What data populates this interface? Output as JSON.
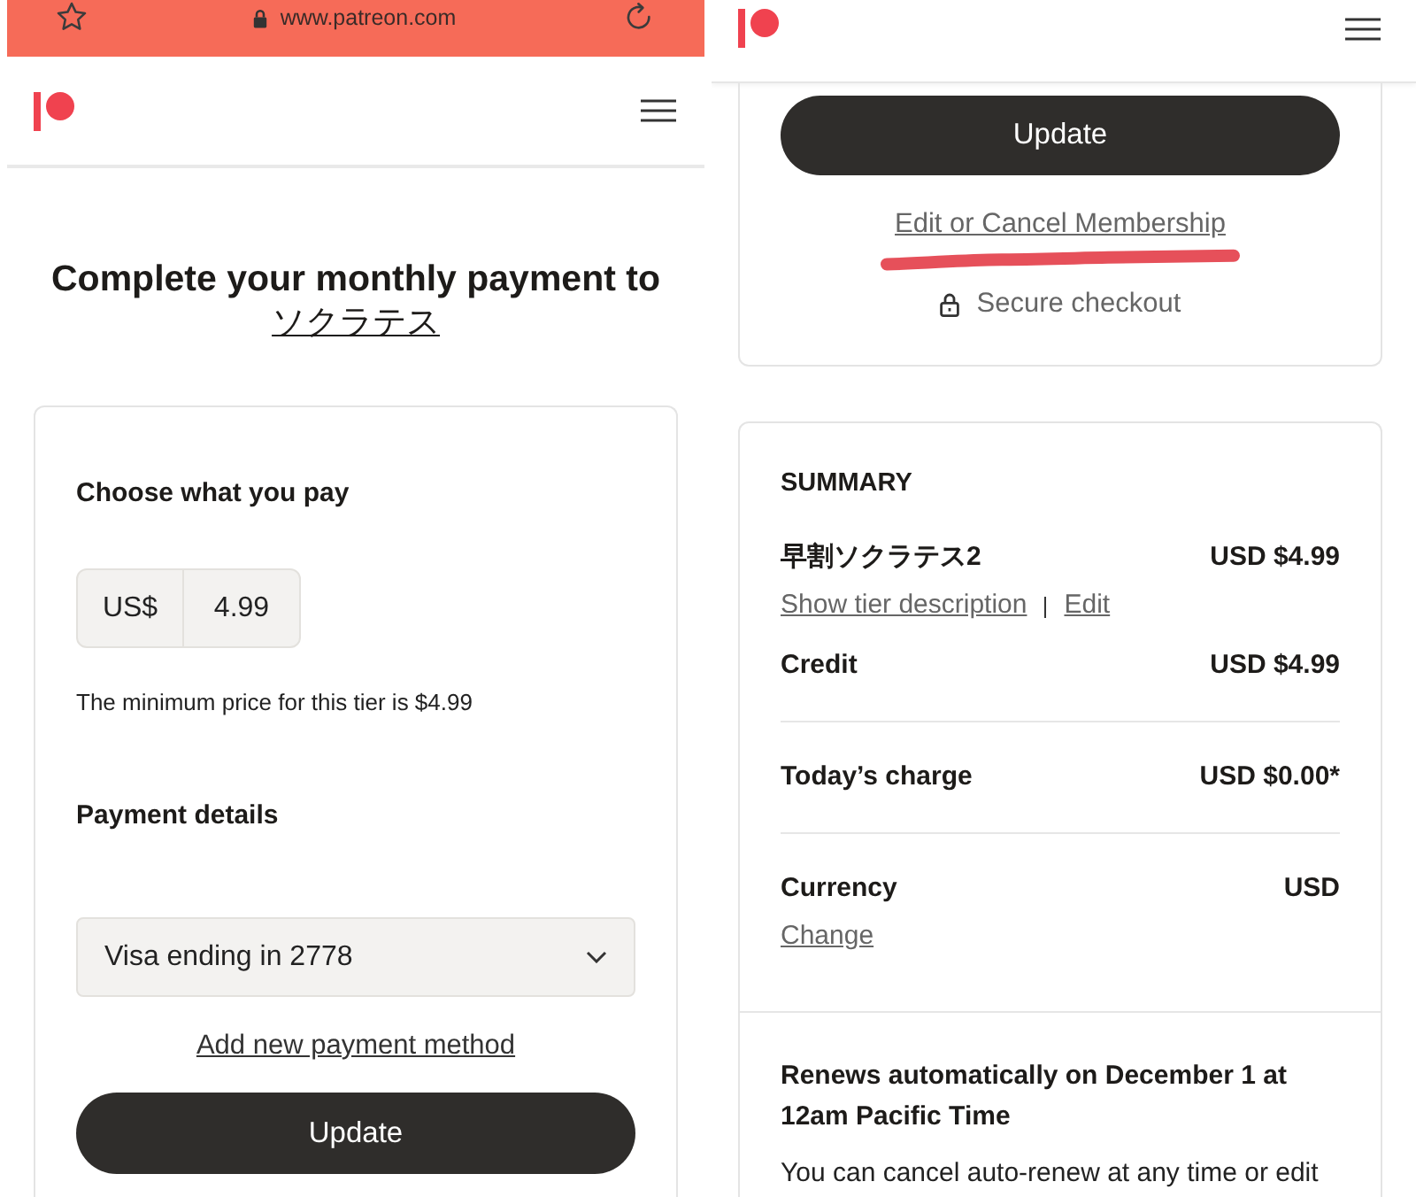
{
  "left_screen": {
    "browser_bar": {
      "url": "www.patreon.com"
    },
    "title": "Complete your monthly payment to",
    "creator_link": "ソクラテス",
    "payment_card": {
      "price_heading": "Choose what you pay",
      "currency": "US$",
      "amount": "4.99",
      "price_hint": "The minimum price for this tier is $4.99",
      "payment_heading": "Payment details",
      "payment_method": "Visa ending in 2778",
      "add_method_link": "Add new payment method",
      "submit_button": "Update"
    }
  },
  "right_screen": {
    "checkout_card": {
      "submit_button": "Update",
      "manage_link": {
        "label": "Edit or Cancel Membership",
        "marked": true
      },
      "secure_note": "Secure checkout"
    },
    "summary_card": {
      "heading": "SUMMARY",
      "sections": [
        {
          "rows": [
            {
              "label": "早割ソクラテス2",
              "amount": "USD $4.99",
              "links": [
                "Show tier description",
                "Edit"
              ]
            },
            {
              "label": "Credit",
              "amount": "USD $4.99"
            }
          ]
        },
        {
          "rows": [
            {
              "label": "Today’s charge",
              "amount": "USD $0.00*"
            }
          ]
        },
        {
          "rows": [
            {
              "label": "Currency",
              "amount": "USD",
              "links": [
                "Change"
              ]
            }
          ]
        }
      ],
      "renewal": {
        "heading": "Renews automatically on December 1 at 12am Pacific Time",
        "text": "You can cancel auto-renew at any time or edit"
      }
    }
  }
}
